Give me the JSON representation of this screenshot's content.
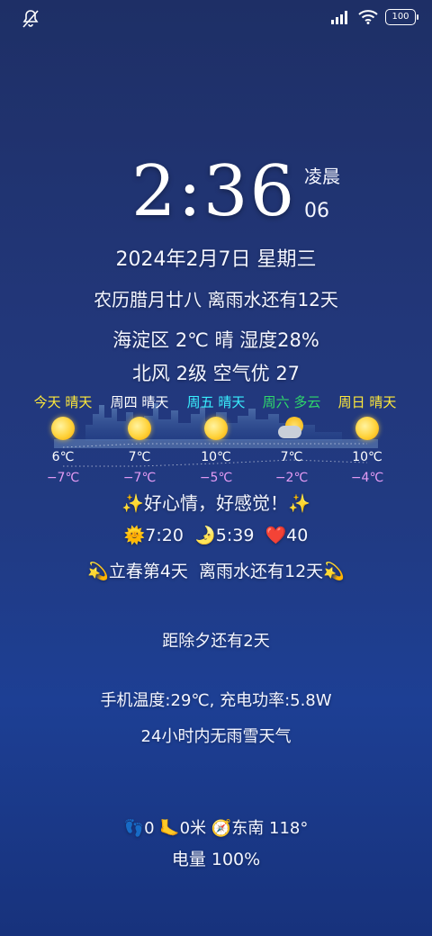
{
  "status_bar": {
    "battery": "100"
  },
  "clock": {
    "time": "2:36",
    "period": "凌晨",
    "seconds": "06"
  },
  "date_line": "2024年2月7日 星期三",
  "lunar_line": "农历腊月廿八 离雨水还有12天",
  "weather_line": "海淀区 2℃ 晴 湿度28%",
  "wind_line": "北风 2级 空气优 27",
  "forecast": [
    {
      "label": "今天 晴天",
      "hi": "6℃",
      "lo": "−7℃",
      "icon": "sun-icon",
      "color": "#ffe93a"
    },
    {
      "label": "周四 晴天",
      "hi": "7℃",
      "lo": "−7℃",
      "icon": "sun-icon",
      "color": "#ffffff"
    },
    {
      "label": "周五 晴天",
      "hi": "10℃",
      "lo": "−5℃",
      "icon": "sun-icon",
      "color": "#39f0ff"
    },
    {
      "label": "周六 多云",
      "hi": "7℃",
      "lo": "−2℃",
      "icon": "partly-cloudy-icon",
      "color": "#2fd86a"
    },
    {
      "label": "周日 晴天",
      "hi": "10℃",
      "lo": "−4℃",
      "icon": "sun-icon",
      "color": "#ffe93a"
    }
  ],
  "mood": {
    "emoji_left": "✨",
    "text": "好心情，好感觉！",
    "emoji_right": "✨"
  },
  "sun_times": {
    "sunrise_emoji": "🌞",
    "sunrise": "7:20",
    "moon_emoji": "🌛",
    "sunset": "5:39",
    "heart_emoji": "❤️",
    "heart_value": "40"
  },
  "solar_term": {
    "emoji_left": "💫",
    "text": "立春第4天  离雨水还有12天",
    "emoji_right": "💫"
  },
  "new_year_eve": "距除夕还有2天",
  "phone_status": "手机温度:29℃, 充电功率:5.8W",
  "rain_forecast": "24小时内无雨雪天气",
  "steps": {
    "foot_emoji": "👣",
    "steps": "0",
    "boot_emoji": "🦶",
    "distance": "0米",
    "compass_emoji": "🧭",
    "direction": "东南 118°"
  },
  "battery_line": "电量 100%"
}
